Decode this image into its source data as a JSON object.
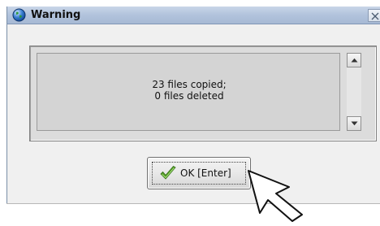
{
  "dialog": {
    "title": "Warning",
    "message_lines": [
      "23 files copied;",
      "0 files deleted"
    ],
    "ok_label": "OK [Enter]"
  },
  "icons": {
    "title": "app-globe-icon",
    "close": "close-icon",
    "scroll_up": "scroll-up-arrow-icon",
    "scroll_down": "scroll-down-arrow-icon",
    "ok": "checkmark-icon",
    "cursor": "mouse-pointer-icon"
  },
  "colors": {
    "title_bar": "#b3c4dd",
    "dialog_bg": "#f0f0f0",
    "message_bg": "#d4d4d4",
    "checkmark": "#5aa02c"
  }
}
